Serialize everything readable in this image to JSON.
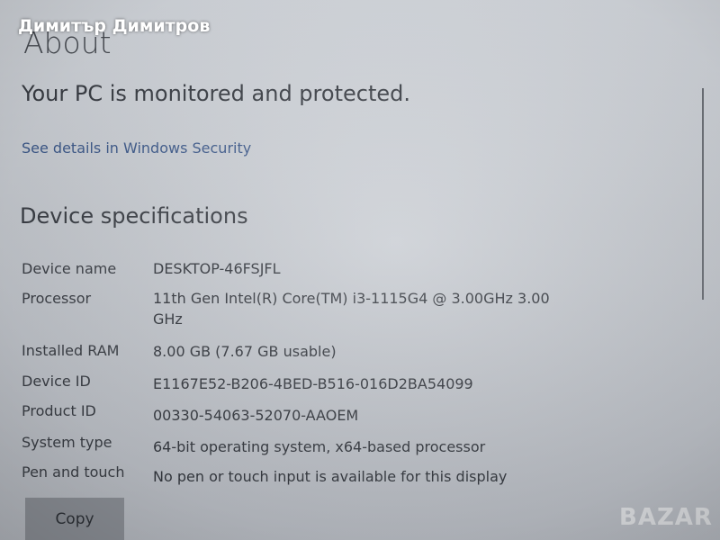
{
  "overlay": {
    "user_name": "Димитър Димитров",
    "logo": "BAZAR"
  },
  "page": {
    "title": "About",
    "protection_message": "Your PC is monitored and protected.",
    "security_link": "See details in Windows Security"
  },
  "device_specs": {
    "title": "Device specifications",
    "rows": [
      {
        "label": "Device name",
        "value": "DESKTOP-46FSJFL"
      },
      {
        "label": "Processor",
        "value": "11th Gen Intel(R) Core(TM) i3-1115G4 @ 3.00GHz   3.00 GHz"
      },
      {
        "label": "Installed RAM",
        "value": "8.00 GB (7.67 GB usable)"
      },
      {
        "label": "Device ID",
        "value": "E1167E52-B206-4BED-B516-016D2BA54099"
      },
      {
        "label": "Product ID",
        "value": "00330-54063-52070-AAOEM"
      },
      {
        "label": "System type",
        "value": "64-bit operating system, x64-based processor"
      },
      {
        "label": "Pen and touch",
        "value": "No pen or touch input is available for this display"
      }
    ],
    "copy_label": "Copy"
  }
}
